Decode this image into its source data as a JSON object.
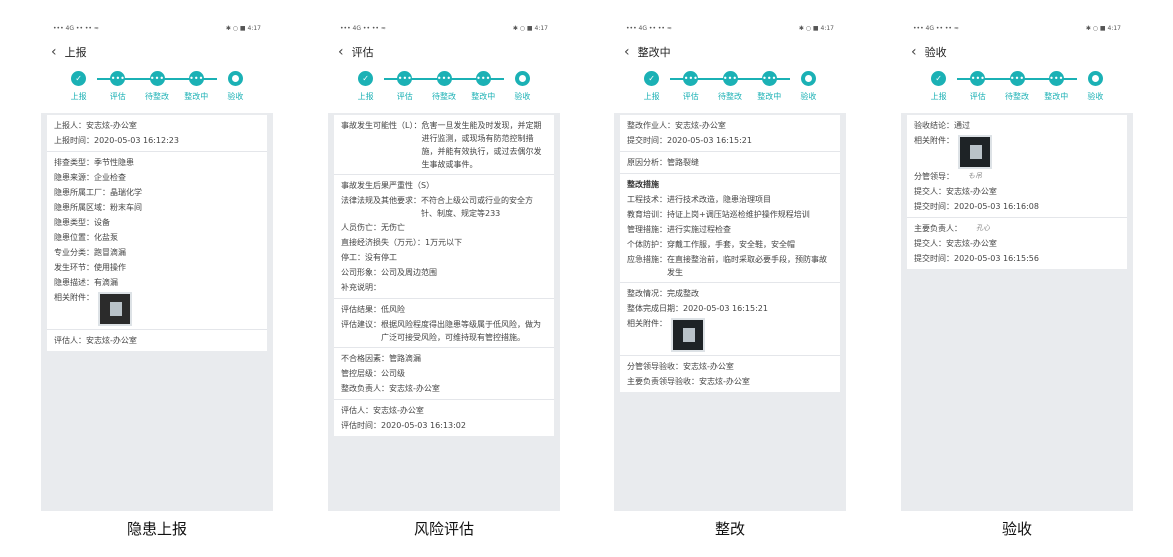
{
  "status": {
    "left": "••• 4G •• •• ≈",
    "right": "✱ ○ ■ 4:17"
  },
  "steps": [
    "上报",
    "评估",
    "待整改",
    "整改中",
    "验收"
  ],
  "screens": [
    {
      "title": "上报",
      "caption": "隐患上报",
      "reporter": "上报人：安志炫-办公室",
      "report_time": "上报时间：2020-05-03 16:12:23",
      "fields": [
        "排查类型：季节性隐患",
        "隐患来源：企业检查",
        "隐患所属工厂：晶瑞化学",
        "隐患所属区域：粉末车间",
        "隐患类型：设备",
        "隐患位置：化盐泵",
        "专业分类：跑冒滴漏",
        "发生环节：使用操作",
        "隐患描述：有滴漏"
      ],
      "attachment_label": "相关附件：",
      "assessor": "评估人：安志炫-办公室"
    },
    {
      "title": "评估",
      "caption": "风险评估",
      "possibility_key": "事故发生可能性（L）：",
      "possibility_val": "危害一旦发生能及时发现，并定期进行监测，或现场有防范控制措施，并能有效执行，或过去偶尔发生事故或事件。",
      "severity_title": "事故发生后果严重性（S）",
      "law_key": "法律法规及其他要求：",
      "law_val": "不符合上级公司或行业的安全方针、制度、规定等233",
      "injury": "人员伤亡：无伤亡",
      "loss": "直接经济损失（万元）：1万元以下",
      "stop": "停工：没有停工",
      "image": "公司形象：公司及周边范围",
      "note": "补充说明：",
      "result": "评估结果：低风险",
      "suggest_key": "评估建议：",
      "suggest_val": "根据风险程度得出隐患等级属于低风险，做为广泛可接受风险，可维持现有管控措施。",
      "nonconform": "不合格因素：管路滴漏",
      "level": "管控层级：公司级",
      "owner": "整改负责人：安志炫-办公室",
      "assessor": "评估人：安志炫-办公室",
      "assess_time": "评估时间：2020-05-03 16:13:02"
    },
    {
      "title": "整改中",
      "caption": "整改",
      "worker": "整改作业人：安志炫-办公室",
      "submit_time": "提交时间：2020-05-03 16:15:21",
      "cause": "原因分析：管路裂缝",
      "measures_title": "整改措施",
      "measures": [
        "工程技术：进行技术改造，隐患治理项目",
        "教育培训：持证上岗+调压站巡检维护操作规程培训",
        "管理措施：进行实施过程检查",
        "个体防护：穿戴工作服，手套，安全鞋，安全帽"
      ],
      "emergency_key": "应急措施：",
      "emergency_val": "在直接整治前，临时采取必要手段，预防事故发生",
      "status": "整改情况：完成整改",
      "finish_date": "整体完成日期：2020-05-03 16:15:21",
      "attachment_label": "相关附件：",
      "leader_accept": "分管领导验收：安志炫-办公室",
      "chief_accept": "主要负责领导验收：安志炫-办公室"
    },
    {
      "title": "验收",
      "caption": "验收",
      "conclusion": "验收结论：通过",
      "attachment_label": "相关附件：",
      "leader": "分管领导：",
      "leader_sig": "も吊",
      "submitter1": "提交人：安志炫-办公室",
      "submit_time1": "提交时间：2020-05-03 16:16:08",
      "chief": "主要负责人：",
      "chief_sig": "孔心",
      "submitter2": "提交人：安志炫-办公室",
      "submit_time2": "提交时间：2020-05-03 16:15:56"
    }
  ]
}
